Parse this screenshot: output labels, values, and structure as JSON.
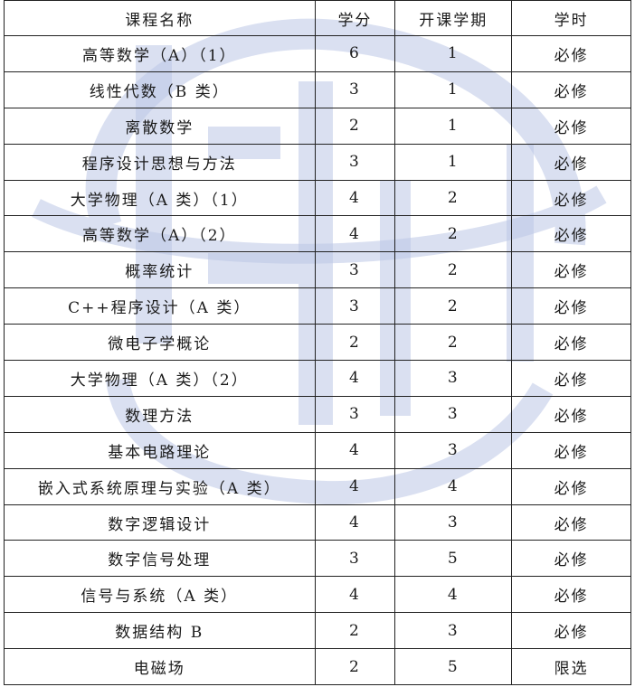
{
  "table": {
    "headers": [
      "课程名称",
      "学分",
      "开课学期",
      "学时"
    ],
    "rows": [
      [
        "高等数学（A）（1）",
        "6",
        "1",
        "必修"
      ],
      [
        "线性代数（B 类）",
        "3",
        "1",
        "必修"
      ],
      [
        "离散数学",
        "2",
        "1",
        "必修"
      ],
      [
        "程序设计思想与方法",
        "3",
        "1",
        "必修"
      ],
      [
        "大学物理（A 类）（1）",
        "4",
        "2",
        "必修"
      ],
      [
        "高等数学（A）（2）",
        "4",
        "2",
        "必修"
      ],
      [
        "概率统计",
        "3",
        "2",
        "必修"
      ],
      [
        "C++程序设计（A 类）",
        "3",
        "2",
        "必修"
      ],
      [
        "微电子学概论",
        "2",
        "2",
        "必修"
      ],
      [
        "大学物理（A 类）（2）",
        "4",
        "3",
        "必修"
      ],
      [
        "数理方法",
        "3",
        "3",
        "必修"
      ],
      [
        "基本电路理论",
        "4",
        "3",
        "必修"
      ],
      [
        "嵌入式系统原理与实验（A 类）",
        "4",
        "4",
        "必修"
      ],
      [
        "数字逻辑设计",
        "4",
        "3",
        "必修"
      ],
      [
        "数字信号处理",
        "3",
        "5",
        "必修"
      ],
      [
        "信号与系统（A 类）",
        "4",
        "4",
        "必修"
      ],
      [
        "数据结构 B",
        "2",
        "3",
        "必修"
      ],
      [
        "电磁场",
        "2",
        "5",
        "限选"
      ]
    ]
  },
  "watermark": {
    "color": "#b9c4e4",
    "icon": "university-logo-watermark"
  }
}
